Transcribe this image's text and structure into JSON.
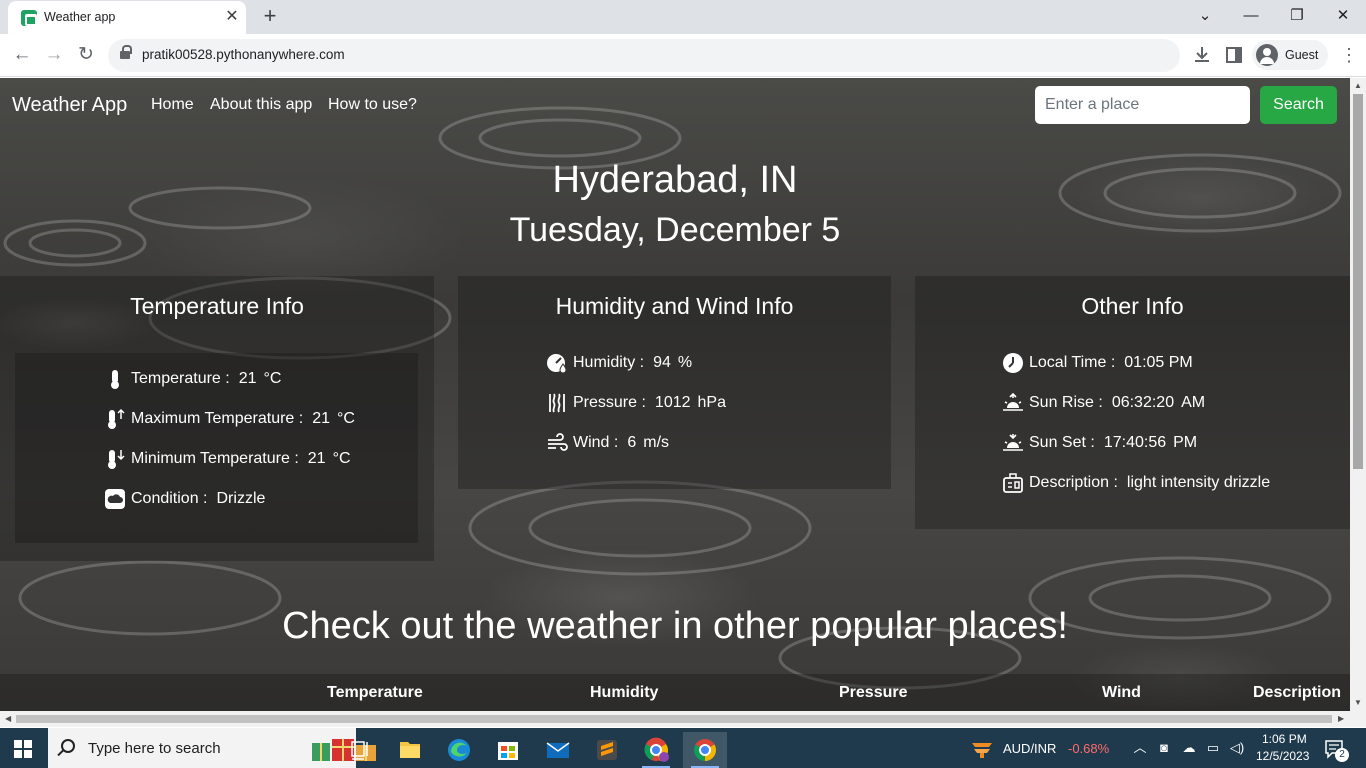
{
  "browser": {
    "tab_title": "Weather app",
    "tab_close": "✕",
    "new_tab": "+",
    "url": "pratik00528.pythonanywhere.com",
    "profile_name": "Guest"
  },
  "nav": {
    "brand": "Weather App",
    "links": [
      "Home",
      "About this app",
      "How to use?"
    ],
    "search_placeholder": "Enter a place",
    "search_button": "Search"
  },
  "location": {
    "city": "Hyderabad, IN",
    "date": "Tuesday, December 5"
  },
  "temperature_card": {
    "title": "Temperature Info",
    "rows": [
      {
        "icon": "thermometer-icon",
        "label": "Temperature :",
        "value": "21",
        "unit": "°C"
      },
      {
        "icon": "thermometer-up-icon",
        "label": "Maximum Temperature :",
        "value": "21",
        "unit": "°C"
      },
      {
        "icon": "thermometer-down-icon",
        "label": "Minimum Temperature :",
        "value": "21",
        "unit": "°C"
      },
      {
        "icon": "cloud-icon",
        "label": "Condition :",
        "value": "Drizzle",
        "unit": ""
      }
    ]
  },
  "humidity_card": {
    "title": "Humidity and Wind Info",
    "rows": [
      {
        "icon": "humidity-gauge-icon",
        "label": "Humidity :",
        "value": "94",
        "unit": "%"
      },
      {
        "icon": "pressure-icon",
        "label": "Pressure :",
        "value": "1012",
        "unit": "hPa"
      },
      {
        "icon": "wind-icon",
        "label": "Wind :",
        "value": "6",
        "unit": "m/s"
      }
    ]
  },
  "other_card": {
    "title": "Other Info",
    "rows": [
      {
        "icon": "clock-icon",
        "label": "Local Time :",
        "value": "01:05 PM",
        "unit": ""
      },
      {
        "icon": "sunrise-icon",
        "label": "Sun Rise :",
        "value": "06:32:20",
        "unit": "AM"
      },
      {
        "icon": "sunset-icon",
        "label": "Sun Set :",
        "value": "17:40:56",
        "unit": "PM"
      },
      {
        "icon": "description-icon",
        "label": "Description :",
        "value": "light intensity drizzle",
        "unit": ""
      }
    ]
  },
  "popular": {
    "title": "Check out the weather in other popular places!",
    "columns": [
      "Temperature",
      "Humidity",
      "Pressure",
      "Wind",
      "Description"
    ]
  },
  "taskbar": {
    "search_text": "Type here to search",
    "ticker_symbol": "AUD/INR",
    "ticker_change": "-0.68%",
    "time": "1:06 PM",
    "date": "12/5/2023",
    "notification_count": "2"
  },
  "colors": {
    "search_button": "#28a745",
    "ticker_negative": "#ff6b6b",
    "taskbar": "#1f3a4d"
  }
}
